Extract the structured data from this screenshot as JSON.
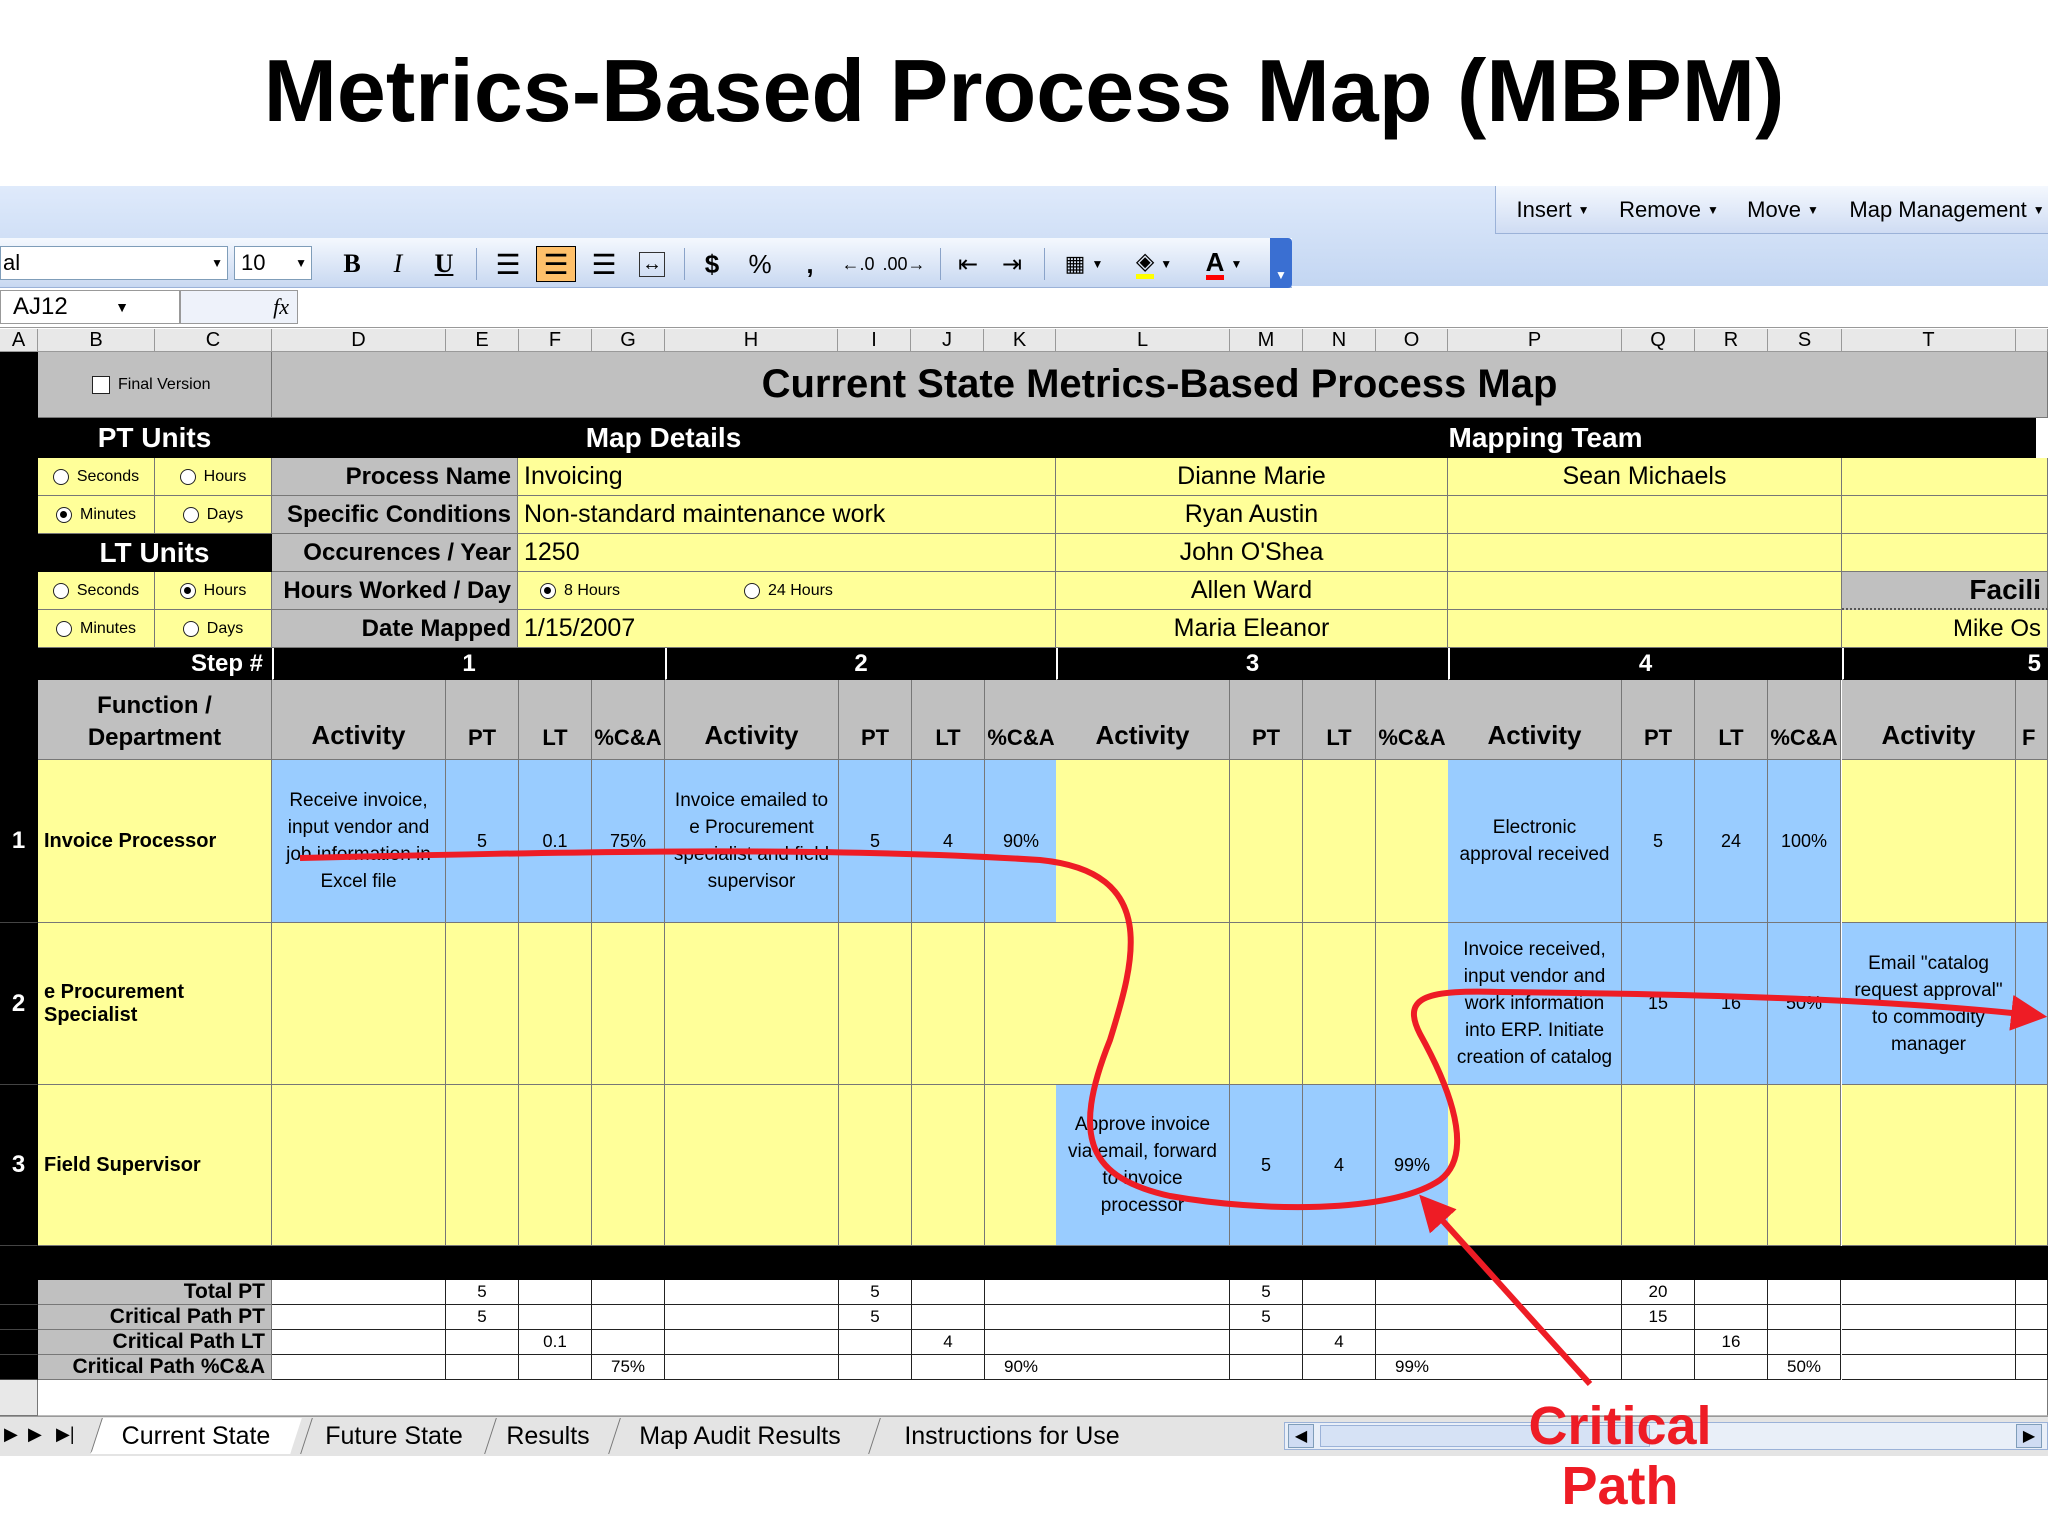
{
  "slide_title": "Metrics-Based Process Map (MBPM)",
  "toolbar": {
    "menu": [
      "Insert",
      "Remove",
      "Move",
      "Map Management"
    ],
    "font_name": "al",
    "font_size": "10",
    "bold": "B",
    "italic": "I",
    "underline": "U",
    "currency": "$",
    "percent": "%",
    "comma": ",",
    "font_color_letter": "A"
  },
  "formula_bar": {
    "name_box": "AJ12",
    "fx": "fx"
  },
  "columns": [
    "A",
    "B",
    "C",
    "D",
    "E",
    "F",
    "G",
    "H",
    "I",
    "J",
    "K",
    "L",
    "M",
    "N",
    "O",
    "P",
    "Q",
    "R",
    "S",
    "T"
  ],
  "sheet": {
    "final_version_label": "Final Version",
    "title": "Current State Metrics-Based Process Map",
    "pt_units_label": "PT Units",
    "lt_units_label": "LT Units",
    "map_details_label": "Map Details",
    "mapping_team_label": "Mapping Team",
    "units": {
      "seconds": "Seconds",
      "hours": "Hours",
      "minutes": "Minutes",
      "days": "Days",
      "pt_selected": "Minutes",
      "lt_selected": "Hours"
    },
    "details": [
      {
        "label": "Process Name",
        "value": "Invoicing"
      },
      {
        "label": "Specific Conditions",
        "value": "Non-standard maintenance work"
      },
      {
        "label": "Occurences / Year",
        "value": "1250"
      },
      {
        "label": "Hours Worked / Day",
        "value": ""
      },
      {
        "label": "Date Mapped",
        "value": "1/15/2007"
      }
    ],
    "hours_options": [
      "8 Hours",
      "24 Hours"
    ],
    "team_col1": [
      "Dianne Marie",
      "Ryan Austin",
      "John O'Shea",
      "Allen Ward",
      "Maria Eleanor"
    ],
    "team_col2": [
      "Sean Michaels",
      "",
      "",
      "",
      ""
    ],
    "facilitator_label": "Facili",
    "facilitator_name": "Mike Os",
    "step_label": "Step #",
    "steps": [
      "1",
      "2",
      "3",
      "4",
      "5"
    ],
    "function_label": "Function / Department",
    "col_headers": {
      "activity": "Activity",
      "pt": "PT",
      "lt": "LT",
      "ca": "%C&A",
      "f": "F"
    },
    "rows": [
      {
        "num": "1",
        "dept": "Invoice Processor"
      },
      {
        "num": "2",
        "dept": "e Procurement Specialist"
      },
      {
        "num": "3",
        "dept": "Field Supervisor"
      }
    ],
    "activities": [
      {
        "text": "Receive invoice, input vendor and job information in Excel file",
        "pt": "5",
        "lt": "0.1",
        "ca": "75%"
      },
      {
        "text": "Invoice emailed to e Procurement specialist and field supervisor",
        "pt": "5",
        "lt": "4",
        "ca": "90%"
      },
      {
        "text": "Approve invoice via email, forward to invoice processor",
        "pt": "5",
        "lt": "4",
        "ca": "99%"
      },
      {
        "text": "Electronic approval received",
        "pt": "5",
        "lt": "24",
        "ca": "100%"
      },
      {
        "text": "Invoice received, input vendor and work information into ERP. Initiate creation of catalog",
        "pt": "15",
        "lt": "16",
        "ca": "50%"
      },
      {
        "text": "Email \"catalog request approval\" to commodity manager",
        "pt": "",
        "lt": "",
        "ca": ""
      }
    ],
    "totals": {
      "labels": [
        "Total PT",
        "Critical Path PT",
        "Critical Path LT",
        "Critical Path %C&A"
      ],
      "step1": {
        "total_pt": "5",
        "cp_pt": "5",
        "cp_lt": "0.1",
        "cp_ca": "75%"
      },
      "step2": {
        "total_pt": "5",
        "cp_pt": "5",
        "cp_lt": "4",
        "cp_ca": "90%"
      },
      "step3": {
        "total_pt": "5",
        "cp_pt": "5",
        "cp_lt": "4",
        "cp_ca": "99%"
      },
      "step4": {
        "total_pt": "20",
        "cp_pt": "15",
        "cp_lt": "16",
        "cp_ca": "50%"
      }
    }
  },
  "sheet_tabs": [
    "Current State",
    "Future State",
    "Results",
    "Map Audit Results",
    "Instructions for Use"
  ],
  "annotation": {
    "line1": "Critical",
    "line2": "Path",
    "color": "#ee1c25"
  }
}
